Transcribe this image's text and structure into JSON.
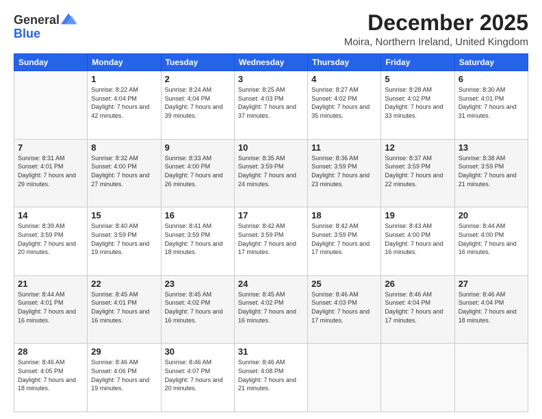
{
  "logo": {
    "general": "General",
    "blue": "Blue"
  },
  "header": {
    "month_title": "December 2025",
    "location": "Moira, Northern Ireland, United Kingdom"
  },
  "weekdays": [
    "Sunday",
    "Monday",
    "Tuesday",
    "Wednesday",
    "Thursday",
    "Friday",
    "Saturday"
  ],
  "weeks": [
    [
      {
        "day": "",
        "sunrise": "",
        "sunset": "",
        "daylight": ""
      },
      {
        "day": "1",
        "sunrise": "Sunrise: 8:22 AM",
        "sunset": "Sunset: 4:04 PM",
        "daylight": "Daylight: 7 hours and 42 minutes."
      },
      {
        "day": "2",
        "sunrise": "Sunrise: 8:24 AM",
        "sunset": "Sunset: 4:04 PM",
        "daylight": "Daylight: 7 hours and 39 minutes."
      },
      {
        "day": "3",
        "sunrise": "Sunrise: 8:25 AM",
        "sunset": "Sunset: 4:03 PM",
        "daylight": "Daylight: 7 hours and 37 minutes."
      },
      {
        "day": "4",
        "sunrise": "Sunrise: 8:27 AM",
        "sunset": "Sunset: 4:02 PM",
        "daylight": "Daylight: 7 hours and 35 minutes."
      },
      {
        "day": "5",
        "sunrise": "Sunrise: 8:28 AM",
        "sunset": "Sunset: 4:02 PM",
        "daylight": "Daylight: 7 hours and 33 minutes."
      },
      {
        "day": "6",
        "sunrise": "Sunrise: 8:30 AM",
        "sunset": "Sunset: 4:01 PM",
        "daylight": "Daylight: 7 hours and 31 minutes."
      }
    ],
    [
      {
        "day": "7",
        "sunrise": "Sunrise: 8:31 AM",
        "sunset": "Sunset: 4:01 PM",
        "daylight": "Daylight: 7 hours and 29 minutes."
      },
      {
        "day": "8",
        "sunrise": "Sunrise: 8:32 AM",
        "sunset": "Sunset: 4:00 PM",
        "daylight": "Daylight: 7 hours and 27 minutes."
      },
      {
        "day": "9",
        "sunrise": "Sunrise: 8:33 AM",
        "sunset": "Sunset: 4:00 PM",
        "daylight": "Daylight: 7 hours and 26 minutes."
      },
      {
        "day": "10",
        "sunrise": "Sunrise: 8:35 AM",
        "sunset": "Sunset: 3:59 PM",
        "daylight": "Daylight: 7 hours and 24 minutes."
      },
      {
        "day": "11",
        "sunrise": "Sunrise: 8:36 AM",
        "sunset": "Sunset: 3:59 PM",
        "daylight": "Daylight: 7 hours and 23 minutes."
      },
      {
        "day": "12",
        "sunrise": "Sunrise: 8:37 AM",
        "sunset": "Sunset: 3:59 PM",
        "daylight": "Daylight: 7 hours and 22 minutes."
      },
      {
        "day": "13",
        "sunrise": "Sunrise: 8:38 AM",
        "sunset": "Sunset: 3:59 PM",
        "daylight": "Daylight: 7 hours and 21 minutes."
      }
    ],
    [
      {
        "day": "14",
        "sunrise": "Sunrise: 8:39 AM",
        "sunset": "Sunset: 3:59 PM",
        "daylight": "Daylight: 7 hours and 20 minutes."
      },
      {
        "day": "15",
        "sunrise": "Sunrise: 8:40 AM",
        "sunset": "Sunset: 3:59 PM",
        "daylight": "Daylight: 7 hours and 19 minutes."
      },
      {
        "day": "16",
        "sunrise": "Sunrise: 8:41 AM",
        "sunset": "Sunset: 3:59 PM",
        "daylight": "Daylight: 7 hours and 18 minutes."
      },
      {
        "day": "17",
        "sunrise": "Sunrise: 8:42 AM",
        "sunset": "Sunset: 3:59 PM",
        "daylight": "Daylight: 7 hours and 17 minutes."
      },
      {
        "day": "18",
        "sunrise": "Sunrise: 8:42 AM",
        "sunset": "Sunset: 3:59 PM",
        "daylight": "Daylight: 7 hours and 17 minutes."
      },
      {
        "day": "19",
        "sunrise": "Sunrise: 8:43 AM",
        "sunset": "Sunset: 4:00 PM",
        "daylight": "Daylight: 7 hours and 16 minutes."
      },
      {
        "day": "20",
        "sunrise": "Sunrise: 8:44 AM",
        "sunset": "Sunset: 4:00 PM",
        "daylight": "Daylight: 7 hours and 16 minutes."
      }
    ],
    [
      {
        "day": "21",
        "sunrise": "Sunrise: 8:44 AM",
        "sunset": "Sunset: 4:01 PM",
        "daylight": "Daylight: 7 hours and 16 minutes."
      },
      {
        "day": "22",
        "sunrise": "Sunrise: 8:45 AM",
        "sunset": "Sunset: 4:01 PM",
        "daylight": "Daylight: 7 hours and 16 minutes."
      },
      {
        "day": "23",
        "sunrise": "Sunrise: 8:45 AM",
        "sunset": "Sunset: 4:02 PM",
        "daylight": "Daylight: 7 hours and 16 minutes."
      },
      {
        "day": "24",
        "sunrise": "Sunrise: 8:45 AM",
        "sunset": "Sunset: 4:02 PM",
        "daylight": "Daylight: 7 hours and 16 minutes."
      },
      {
        "day": "25",
        "sunrise": "Sunrise: 8:46 AM",
        "sunset": "Sunset: 4:03 PM",
        "daylight": "Daylight: 7 hours and 17 minutes."
      },
      {
        "day": "26",
        "sunrise": "Sunrise: 8:46 AM",
        "sunset": "Sunset: 4:04 PM",
        "daylight": "Daylight: 7 hours and 17 minutes."
      },
      {
        "day": "27",
        "sunrise": "Sunrise: 8:46 AM",
        "sunset": "Sunset: 4:04 PM",
        "daylight": "Daylight: 7 hours and 18 minutes."
      }
    ],
    [
      {
        "day": "28",
        "sunrise": "Sunrise: 8:46 AM",
        "sunset": "Sunset: 4:05 PM",
        "daylight": "Daylight: 7 hours and 18 minutes."
      },
      {
        "day": "29",
        "sunrise": "Sunrise: 8:46 AM",
        "sunset": "Sunset: 4:06 PM",
        "daylight": "Daylight: 7 hours and 19 minutes."
      },
      {
        "day": "30",
        "sunrise": "Sunrise: 8:46 AM",
        "sunset": "Sunset: 4:07 PM",
        "daylight": "Daylight: 7 hours and 20 minutes."
      },
      {
        "day": "31",
        "sunrise": "Sunrise: 8:46 AM",
        "sunset": "Sunset: 4:08 PM",
        "daylight": "Daylight: 7 hours and 21 minutes."
      },
      {
        "day": "",
        "sunrise": "",
        "sunset": "",
        "daylight": ""
      },
      {
        "day": "",
        "sunrise": "",
        "sunset": "",
        "daylight": ""
      },
      {
        "day": "",
        "sunrise": "",
        "sunset": "",
        "daylight": ""
      }
    ]
  ]
}
